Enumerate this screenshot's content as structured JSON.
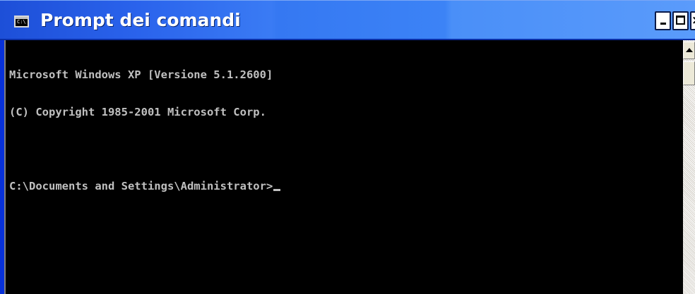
{
  "window": {
    "title": "Prompt dei comandi",
    "system_icon": "cmd-console-icon",
    "system_icon_glyph": "C:\\",
    "controls": {
      "minimize_icon": "minimize-icon",
      "maximize_icon": "maximize-icon",
      "close_icon": "close-icon",
      "close_glyph": "×"
    }
  },
  "console": {
    "lines": [
      "Microsoft Windows XP [Versione 5.1.2600]",
      "(C) Copyright 1985-2001 Microsoft Corp.",
      "",
      "C:\\Documents and Settings\\Administrator>"
    ],
    "text_color": "#c0c0c0",
    "background_color": "#000000"
  },
  "scrollbar": {
    "up_icon": "arrow-up-icon"
  }
}
